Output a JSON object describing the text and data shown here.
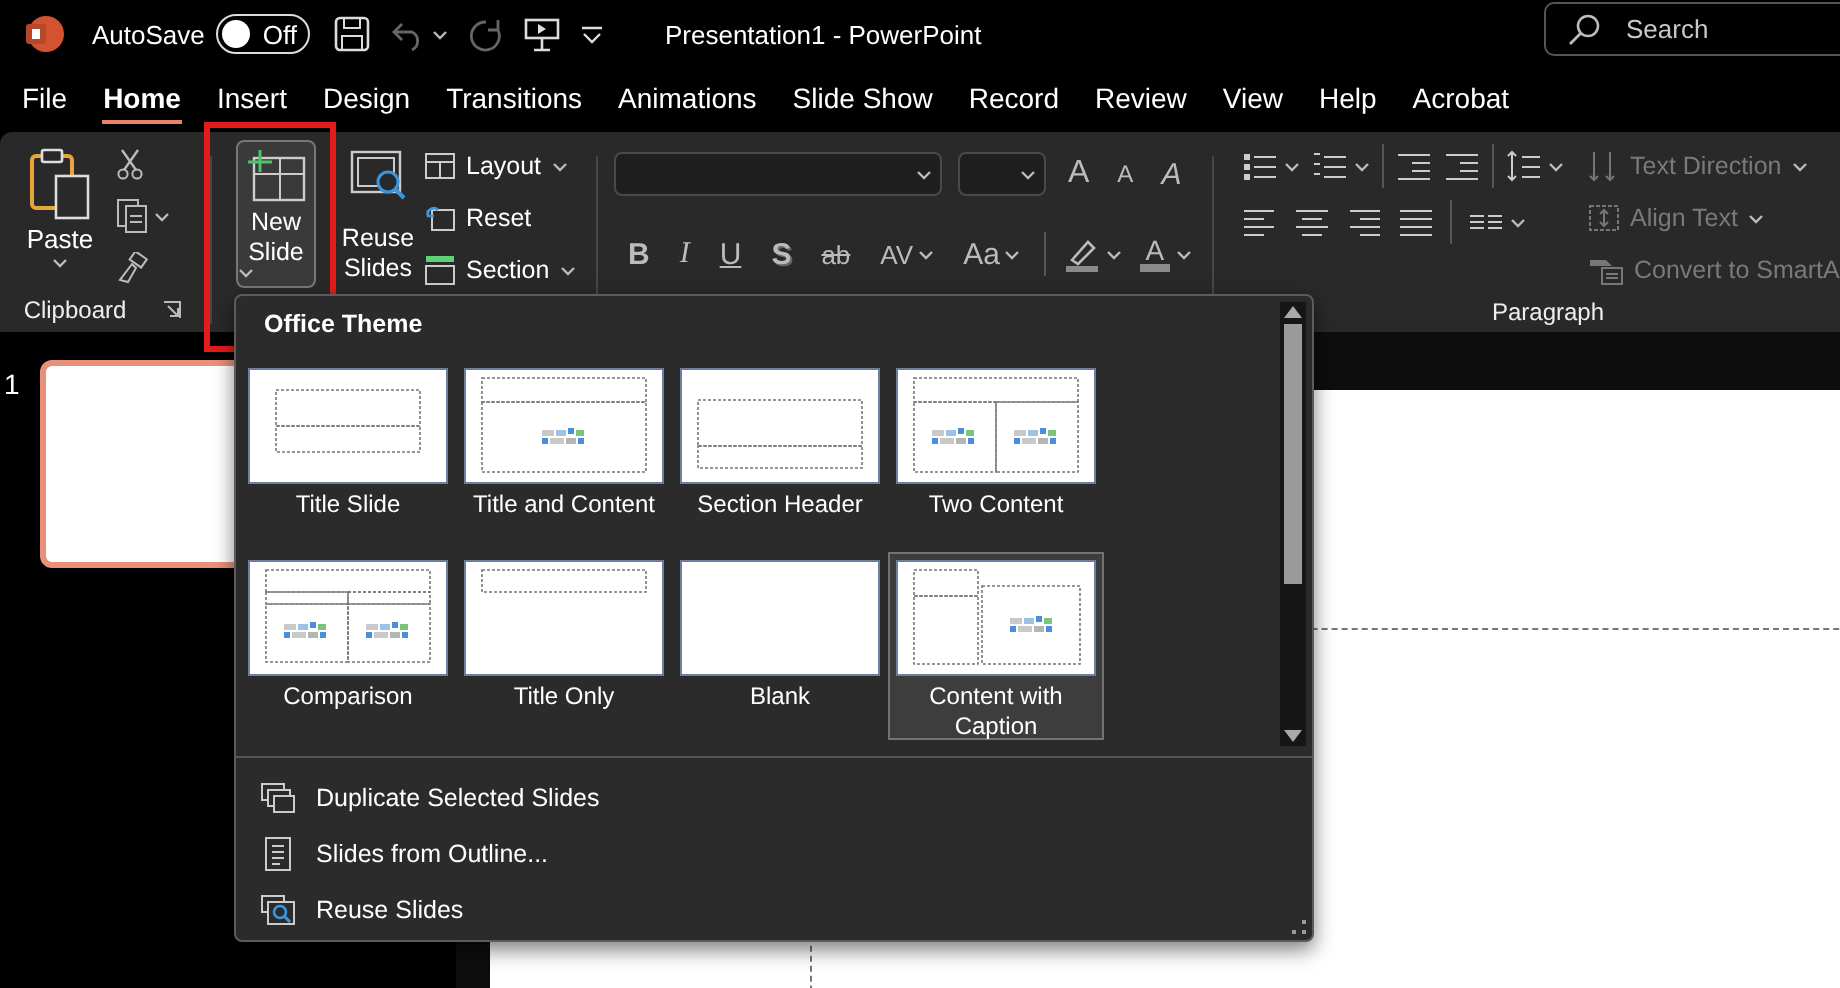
{
  "title_bar": {
    "autosave_label": "AutoSave",
    "autosave_toggle": {
      "label": "Off",
      "on": false
    },
    "title": "Presentation1  -  PowerPoint",
    "search": {
      "placeholder": "Search"
    }
  },
  "tabs": [
    {
      "label": "File",
      "selected": false
    },
    {
      "label": "Home",
      "selected": true
    },
    {
      "label": "Insert",
      "selected": false
    },
    {
      "label": "Design",
      "selected": false
    },
    {
      "label": "Transitions",
      "selected": false
    },
    {
      "label": "Animations",
      "selected": false
    },
    {
      "label": "Slide Show",
      "selected": false
    },
    {
      "label": "Record",
      "selected": false
    },
    {
      "label": "Review",
      "selected": false
    },
    {
      "label": "View",
      "selected": false
    },
    {
      "label": "Help",
      "selected": false
    },
    {
      "label": "Acrobat",
      "selected": false
    }
  ],
  "ribbon": {
    "clipboard": {
      "paste": "Paste",
      "label": "Clipboard"
    },
    "slides": {
      "new_slide": {
        "label": "New Slide",
        "highlighted": true
      },
      "reuse_slides": "Reuse Slides",
      "items": [
        {
          "kind": "layout",
          "label": "Layout",
          "dropdown": true
        },
        {
          "kind": "reset",
          "label": "Reset",
          "dropdown": false
        },
        {
          "kind": "section",
          "label": "Section",
          "dropdown": true
        }
      ]
    },
    "font": {
      "row1": [
        {
          "kind": "grow",
          "text": "A"
        },
        {
          "kind": "shrink",
          "text": "A"
        },
        {
          "kind": "clear",
          "text": "A"
        }
      ],
      "row2": [
        {
          "kind": "bold",
          "text": "B",
          "dropdown": false
        },
        {
          "kind": "italic",
          "text": "I",
          "dropdown": false
        },
        {
          "kind": "underline",
          "text": "U",
          "dropdown": false
        },
        {
          "kind": "shadow",
          "text": "S",
          "dropdown": false
        },
        {
          "kind": "strike",
          "text": "ab",
          "dropdown": false
        },
        {
          "kind": "spacing",
          "text": "AV",
          "dropdown": true
        },
        {
          "kind": "case",
          "text": "Aa",
          "dropdown": true
        }
      ],
      "font_color": {
        "text": "A",
        "color": "#8a8a8a"
      }
    },
    "paragraph": {
      "label": "Paragraph",
      "items": [
        {
          "kind": "direction",
          "label": "Text Direction",
          "dropdown": true,
          "disabled": true
        },
        {
          "kind": "align",
          "label": "Align Text",
          "dropdown": true,
          "disabled": true
        },
        {
          "kind": "smartart",
          "label": "Convert to SmartA",
          "dropdown": false,
          "disabled": true
        }
      ]
    }
  },
  "gallery": {
    "title": "Office Theme",
    "layouts": [
      {
        "kind": "title",
        "label": "Title Slide",
        "selected": false
      },
      {
        "kind": "title-content",
        "label": "Title and Content",
        "selected": false
      },
      {
        "kind": "section",
        "label": "Section Header",
        "selected": false
      },
      {
        "kind": "two-content",
        "label": "Two Content",
        "selected": false
      },
      {
        "kind": "comparison",
        "label": "Comparison",
        "selected": false
      },
      {
        "kind": "title-only",
        "label": "Title Only",
        "selected": false
      },
      {
        "kind": "blank",
        "label": "Blank",
        "selected": false
      },
      {
        "kind": "content-caption",
        "label": "Content with Caption",
        "selected": true
      }
    ]
  },
  "menu_items": [
    {
      "kind": "duplicate",
      "label": "Duplicate Selected Slides"
    },
    {
      "kind": "outline",
      "label": "Slides from Outline..."
    },
    {
      "kind": "reuse",
      "label": "Reuse Slides"
    }
  ],
  "slide_pane": {
    "slides": [
      {
        "number": "1",
        "selected": true
      }
    ]
  }
}
